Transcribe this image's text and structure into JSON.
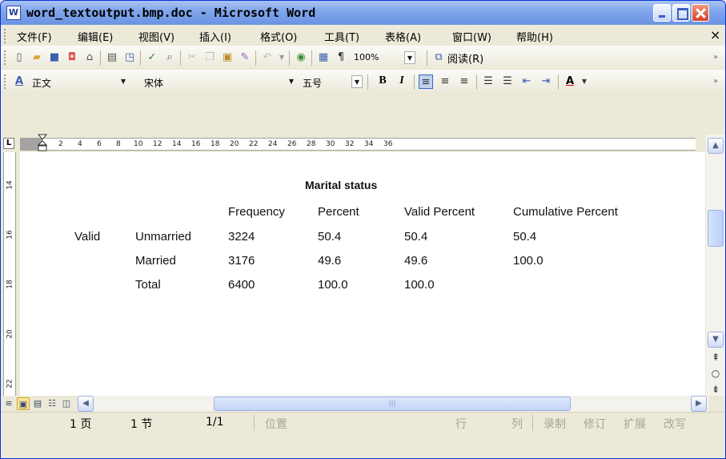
{
  "window": {
    "title": "word_textoutput.bmp.doc - Microsoft Word",
    "app_icon_letter": "W"
  },
  "menubar": {
    "items": [
      "文件(F)",
      "编辑(E)",
      "视图(V)",
      "插入(I)",
      "格式(O)",
      "工具(T)",
      "表格(A)",
      "窗口(W)",
      "帮助(H)"
    ],
    "close_glyph": "×"
  },
  "toolbar": {
    "zoom": "100%",
    "read_label": "阅读(R)"
  },
  "format_toolbar": {
    "style_icon_label": "A",
    "style": "正文",
    "font": "宋体",
    "size": "五号",
    "bold_label": "B",
    "italic_label": "I",
    "font_color_label": "A"
  },
  "ruler": {
    "corner_label": "L",
    "h_ticks": [
      "2",
      "4",
      "6",
      "8",
      "10",
      "12",
      "14",
      "16",
      "18",
      "20",
      "22",
      "24",
      "26",
      "28",
      "30",
      "32",
      "34",
      "36"
    ],
    "v_ticks": [
      "14",
      "16",
      "18",
      "20",
      "22"
    ]
  },
  "document": {
    "table_title": "Marital status",
    "headers": [
      "Frequency",
      "Percent",
      "Valid Percent",
      "Cumulative Percent"
    ],
    "row_group": "Valid",
    "rows": [
      {
        "label": "Unmarried",
        "frequency": "3224",
        "percent": "50.4",
        "valid_percent": "50.4",
        "cumulative_percent": "50.4"
      },
      {
        "label": "Married",
        "frequency": "3176",
        "percent": "49.6",
        "valid_percent": "49.6",
        "cumulative_percent": "100.0"
      },
      {
        "label": "Total",
        "frequency": "6400",
        "percent": "100.0",
        "valid_percent": "100.0",
        "cumulative_percent": ""
      }
    ]
  },
  "statusbar": {
    "page": "1 页",
    "section": "1 节",
    "page_of": "1/1",
    "position": "位置",
    "line": "行",
    "column": "列",
    "record": "录制",
    "revise": "修订",
    "extend": "扩展",
    "overtype": "改写"
  },
  "colors": {
    "title_bar": "#7fa4ea",
    "chrome": "#ece9d8",
    "close_button": "#d5402a",
    "page": "#ffffff"
  }
}
